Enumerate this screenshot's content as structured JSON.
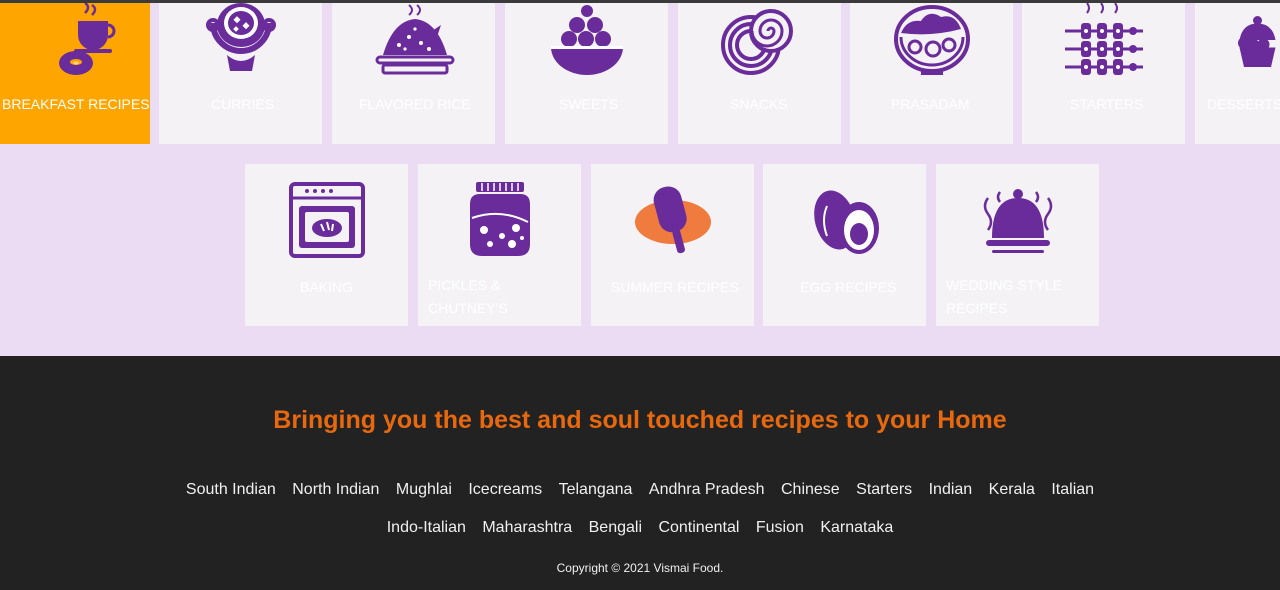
{
  "categories": {
    "row1": [
      {
        "label": "BREAKFAST RECIPES",
        "icon": "breakfast-icon"
      },
      {
        "label": "CURRIES",
        "icon": "curry-pot-icon"
      },
      {
        "label": "FLAVORED RICE",
        "icon": "rice-plate-icon"
      },
      {
        "label": "SWEETS",
        "icon": "sweets-bowl-icon"
      },
      {
        "label": "SNACKS",
        "icon": "snacks-icon"
      },
      {
        "label": "PRASADAM",
        "icon": "prasadam-bowl-icon"
      },
      {
        "label": "STARTERS",
        "icon": "skewers-icon"
      },
      {
        "label": "DESSERTS A",
        "icon": "dessert-icon"
      }
    ],
    "row2": [
      {
        "label": "BAKING",
        "icon": "oven-icon"
      },
      {
        "label": "PICKLES & CHUTNEY'S",
        "icon": "pickle-jar-icon"
      },
      {
        "label": "SUMMER RECIPES",
        "icon": "popsicle-icon"
      },
      {
        "label": "EGG RECIPES",
        "icon": "eggs-icon"
      },
      {
        "label": "WEDDING STYLE RECIPES",
        "icon": "cloche-icon"
      }
    ],
    "active_color": "#ffa500",
    "icon_color": "#6a2c9a"
  },
  "footer": {
    "tagline": "Bringing you the best and soul touched recipes to your Home",
    "links_row1": [
      "South Indian",
      "North Indian",
      "Mughlai",
      "Icecreams",
      "Telangana",
      "Andhra Pradesh",
      "Chinese",
      "Starters",
      "Indian",
      "Kerala",
      "Italian"
    ],
    "links_row2": [
      "Indo-Italian",
      "Maharashtra",
      "Bengali",
      "Continental",
      "Fusion",
      "Karnataka"
    ],
    "copyright": "Copyright © 2021 Vismai Food."
  }
}
